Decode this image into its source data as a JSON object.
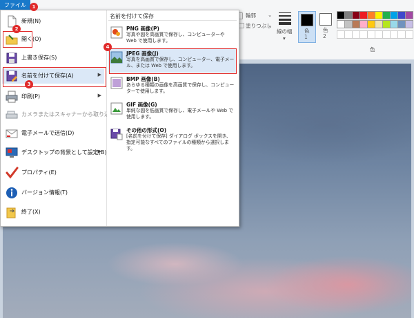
{
  "ribbon": {
    "file_tab": "ファイル",
    "outline_label": "輪郭",
    "fill_label": "塗りつぶし",
    "line_width_label": "線の幅",
    "color1_label": "色\n1",
    "color2_label": "色\n2",
    "colors_group_label": "色",
    "palette_row1": [
      "#000000",
      "#7f7f7f",
      "#880015",
      "#ed1c24",
      "#ff7f27",
      "#fff200",
      "#22b14c",
      "#00a2e8",
      "#3f48cc",
      "#a349a4"
    ],
    "palette_row2": [
      "#ffffff",
      "#c3c3c3",
      "#b97a57",
      "#ffaec9",
      "#ffc90e",
      "#efe4b0",
      "#b5e61d",
      "#99d9ea",
      "#7092be",
      "#c8bfe7"
    ]
  },
  "menu": {
    "items": [
      {
        "label": "新規(N)",
        "icon": "new-file-icon"
      },
      {
        "label": "開く(O)",
        "icon": "open-folder-icon"
      },
      {
        "label": "上書き保存(S)",
        "icon": "save-icon"
      },
      {
        "label": "名前を付けて保存(A)",
        "icon": "save-as-icon"
      },
      {
        "label": "印刷(P)",
        "icon": "printer-icon"
      },
      {
        "label": "カメラまたはスキャナーから取り込み(M)",
        "icon": "scanner-icon"
      },
      {
        "label": "電子メールで送信(D)",
        "icon": "email-icon"
      },
      {
        "label": "デスクトップの背景として設定(B)",
        "icon": "desktop-icon"
      },
      {
        "label": "プロパティ(E)",
        "icon": "checkmark-icon"
      },
      {
        "label": "バージョン情報(T)",
        "icon": "info-icon"
      },
      {
        "label": "終了(X)",
        "icon": "exit-icon"
      }
    ]
  },
  "submenu": {
    "title": "名前を付けて保存",
    "items": [
      {
        "title": "PNG 画像(P)",
        "desc": "写真や図を高画質で保存し、コンピューターや Web で使用します。",
        "icon": "png-image-icon"
      },
      {
        "title": "JPEG 画像(J)",
        "desc": "写真を高画質で保存し、コンピューター、電子メール、または Web で使用します。",
        "icon": "jpeg-image-icon"
      },
      {
        "title": "BMP 画像(B)",
        "desc": "あらゆる種類の画像を高画質で保存し、コンピューターで使用します。",
        "icon": "bmp-image-icon"
      },
      {
        "title": "GIF 画像(G)",
        "desc": "単純な図を低画質で保存し、電子メールや Web で使用します。",
        "icon": "gif-image-icon"
      },
      {
        "title": "その他の形式(O)",
        "desc": "[名前を付けて保存] ダイアログ ボックスを開き、指定可能なすべてのファイルの種類から選択します。",
        "icon": "other-format-icon"
      }
    ]
  },
  "steps": [
    "1",
    "2",
    "3",
    "4"
  ],
  "colors": {
    "accent": "#1979ca",
    "highlight": "#e02a2a",
    "hover": "#dbe8f7"
  }
}
